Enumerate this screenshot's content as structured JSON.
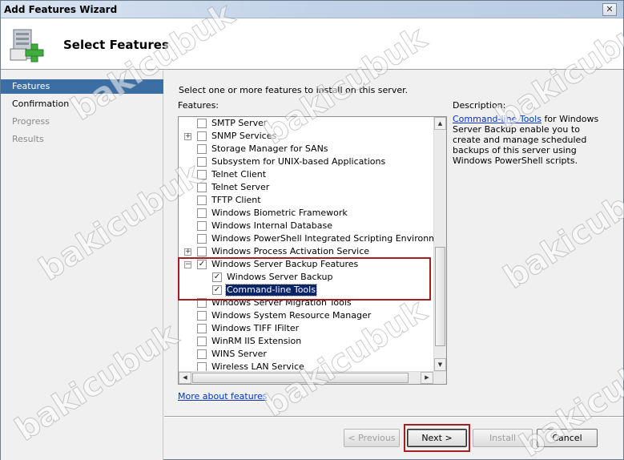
{
  "window": {
    "title": "Add Features Wizard",
    "close_glyph": "✕"
  },
  "header": {
    "title": "Select Features",
    "icon": "server-add-icon"
  },
  "nav": {
    "items": [
      {
        "label": "Features",
        "state": "active"
      },
      {
        "label": "Confirmation",
        "state": "normal"
      },
      {
        "label": "Progress",
        "state": "disabled"
      },
      {
        "label": "Results",
        "state": "disabled"
      }
    ]
  },
  "content": {
    "instruction": "Select one or more features to install on this server.",
    "features_label": "Features:",
    "description_label": "Description:",
    "description_link": "Command-line Tools",
    "description_body": " for Windows Server Backup enable you to create and manage scheduled backups of this server using Windows PowerShell scripts.",
    "more_link": "More about features",
    "tree": [
      {
        "label": "SMTP Server",
        "expander": false,
        "checked": false,
        "indent": 0
      },
      {
        "label": "SNMP Services",
        "expander": true,
        "expander_glyph": "+",
        "checked": false,
        "indent": 0
      },
      {
        "label": "Storage Manager for SANs",
        "expander": false,
        "checked": false,
        "indent": 0
      },
      {
        "label": "Subsystem for UNIX-based Applications",
        "expander": false,
        "checked": false,
        "indent": 0
      },
      {
        "label": "Telnet Client",
        "expander": false,
        "checked": false,
        "indent": 0
      },
      {
        "label": "Telnet Server",
        "expander": false,
        "checked": false,
        "indent": 0
      },
      {
        "label": "TFTP Client",
        "expander": false,
        "checked": false,
        "indent": 0
      },
      {
        "label": "Windows Biometric Framework",
        "expander": false,
        "checked": false,
        "indent": 0
      },
      {
        "label": "Windows Internal Database",
        "expander": false,
        "checked": false,
        "indent": 0
      },
      {
        "label": "Windows PowerShell Integrated Scripting Environment (IS",
        "expander": false,
        "checked": false,
        "indent": 0
      },
      {
        "label": "Windows Process Activation Service",
        "expander": true,
        "expander_glyph": "+",
        "checked": false,
        "indent": 0
      },
      {
        "label": "Windows Server Backup Features",
        "expander": true,
        "expander_glyph": "−",
        "checked": true,
        "indent": 0
      },
      {
        "label": "Windows Server Backup",
        "expander": false,
        "checked": true,
        "indent": 1
      },
      {
        "label": "Command-line Tools",
        "expander": false,
        "checked": true,
        "indent": 1,
        "selected": true
      },
      {
        "label": "Windows Server Migration Tools",
        "expander": false,
        "checked": false,
        "indent": 0
      },
      {
        "label": "Windows System Resource Manager",
        "expander": false,
        "checked": false,
        "indent": 0
      },
      {
        "label": "Windows TIFF IFilter",
        "expander": false,
        "checked": false,
        "indent": 0
      },
      {
        "label": "WinRM IIS Extension",
        "expander": false,
        "checked": false,
        "indent": 0
      },
      {
        "label": "WINS Server",
        "expander": false,
        "checked": false,
        "indent": 0
      },
      {
        "label": "Wireless LAN Service",
        "expander": false,
        "checked": false,
        "indent": 0
      }
    ],
    "check_glyph": "✓"
  },
  "buttons": {
    "previous": "< Previous",
    "next": "Next >",
    "install": "Install",
    "cancel": "Cancel"
  },
  "scroll": {
    "up": "▲",
    "down": "▼",
    "left": "◀",
    "right": "▶"
  },
  "watermark": "bakicubuk"
}
